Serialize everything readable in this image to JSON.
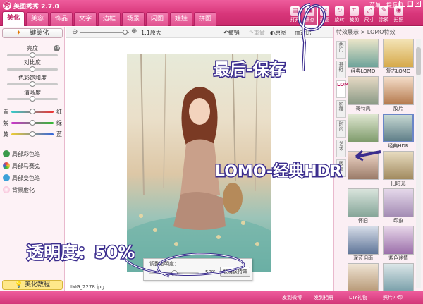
{
  "app": {
    "title": "美图秀秀 2.7.0",
    "logo_glyph": "秀"
  },
  "tabs": [
    "美化",
    "美容",
    "饰品",
    "文字",
    "边框",
    "场景",
    "闪图",
    "娃娃",
    "拼图"
  ],
  "top_menu": [
    "菜单",
    "提意见"
  ],
  "tools": [
    "打开",
    "保存",
    "抠图",
    "旋转",
    "裁剪",
    "尺寸",
    "涂鸦",
    "拍照"
  ],
  "left_panel": {
    "one_click_label": "一键美化",
    "adjust_labels": [
      "亮度",
      "对比度",
      "色彩饱和度",
      "清晰度"
    ],
    "color_balance": [
      {
        "left": "青",
        "right": "红"
      },
      {
        "left": "紫",
        "right": "绿"
      },
      {
        "left": "黄",
        "right": "蓝"
      }
    ],
    "brushes": [
      "局部彩色笔",
      "局部马赛克",
      "局部变色笔",
      "背景虚化"
    ],
    "tutorial_label": "美化教程"
  },
  "toolbar2": {
    "zoom_label": "1:1原大",
    "undo": "撤销",
    "redo": "重做",
    "original": "原图",
    "compare": "对比"
  },
  "canvas": {
    "filename": "IMG_2278.jpg"
  },
  "opacity_dialog": {
    "title": "调整透明度：",
    "value": "50%",
    "cancel_label": "取消该特效",
    "level": 0.5
  },
  "right_panel": {
    "header": "特效展示 > LOMO特效",
    "side_tabs": [
      "热门",
      "基础",
      "LOMO",
      "影楼",
      "时尚",
      "艺术",
      "版画"
    ],
    "active_side_tab": 2,
    "effects": [
      {
        "label": "经典LOMO",
        "colors": [
          "#e9e4c8",
          "#6ea39a"
        ]
      },
      {
        "label": "复古LOMO",
        "colors": [
          "#f3e3b5",
          "#d6a94a"
        ]
      },
      {
        "label": "哥特风",
        "colors": [
          "#e6d9c4",
          "#8a9a86"
        ]
      },
      {
        "label": "胶片",
        "colors": [
          "#f4ddc9",
          "#b57a4e"
        ]
      },
      {
        "label": "",
        "colors": [
          "#dfe7d1",
          "#7f9b6c"
        ]
      },
      {
        "label": "经典HDR",
        "colors": [
          "#c6d8d2",
          "#5f7e88"
        ]
      },
      {
        "label": "",
        "colors": [
          "#f0d7c9",
          "#9a7b68"
        ]
      },
      {
        "label": "旧时光",
        "colors": [
          "#e8dcc0",
          "#a18a5f"
        ]
      },
      {
        "label": "怀旧",
        "colors": [
          "#d9e4dc",
          "#86a699"
        ]
      },
      {
        "label": "印象",
        "colors": [
          "#e5d8ea",
          "#a48cb4"
        ]
      },
      {
        "label": "深蓝泪雨",
        "colors": [
          "#d6dce8",
          "#5f7598"
        ]
      },
      {
        "label": "紫色迷情",
        "colors": [
          "#e6d5e8",
          "#9b6faa"
        ]
      },
      {
        "label": "",
        "colors": [
          "#efe4d4",
          "#b89a78"
        ]
      },
      {
        "label": "",
        "colors": [
          "#dbe6e8",
          "#7aa0aa"
        ]
      }
    ],
    "selected_index": 5
  },
  "status_bar": [
    "发到微博",
    "发到相册",
    "DIY礼物",
    "照片冲印"
  ],
  "annotations": {
    "save_note": "最后-保存",
    "effect_note": "LOMO-经典HDR",
    "opacity_note": "透明度：50%"
  },
  "colors": {
    "brand": "#d8367a",
    "annotation": "#3b2d8e",
    "selected": "#6a86c8"
  }
}
